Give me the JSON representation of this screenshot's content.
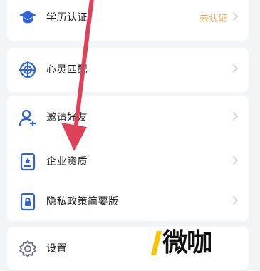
{
  "menu": {
    "items": [
      {
        "label": "学历认证",
        "action": "去认证",
        "icon": "graduation-cap-icon"
      },
      {
        "label": "心灵匹配",
        "icon": "compass-icon"
      },
      {
        "label": "邀请好友",
        "icon": "user-plus-icon"
      },
      {
        "label": "企业资质",
        "icon": "certificate-icon"
      },
      {
        "label": "隐私政策简要版",
        "icon": "lock-doc-icon"
      },
      {
        "label": "设置",
        "icon": "gear-icon"
      }
    ]
  },
  "watermark": {
    "text": "微咖"
  },
  "colors": {
    "accent": "#2f63d6",
    "action": "#f0a14a",
    "arrow": "#e0415a",
    "background": "#f3f4f6"
  }
}
